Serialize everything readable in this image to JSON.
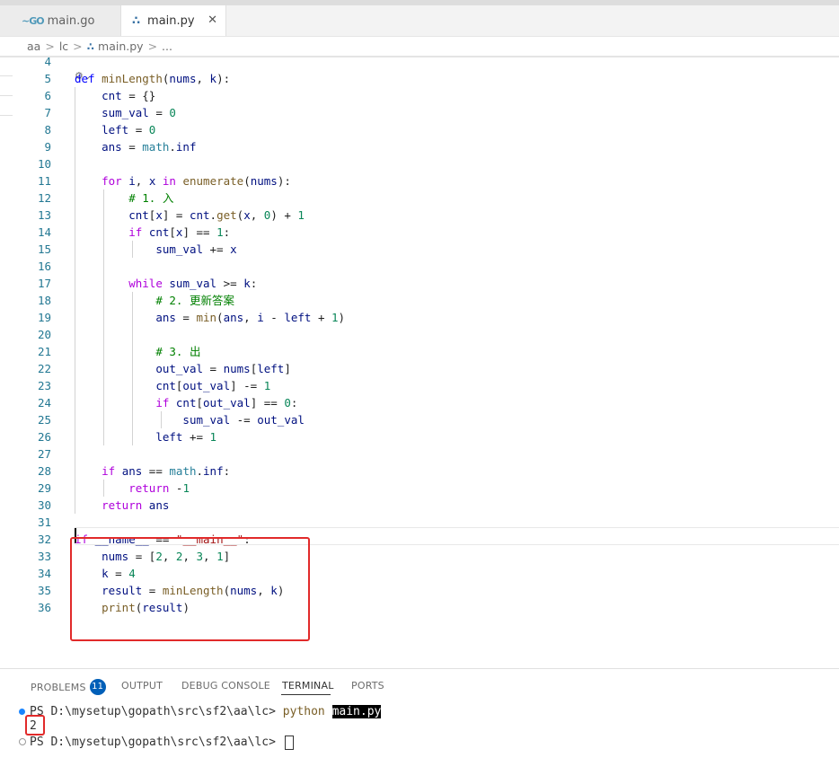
{
  "tabs": [
    {
      "label": "main.go",
      "icon": "go-file-icon",
      "active": false
    },
    {
      "label": "main.py",
      "icon": "python-file-icon",
      "active": true
    }
  ],
  "tab_close_glyph": "✕",
  "breadcrumb": {
    "items": [
      "aa",
      "lc",
      "main.py",
      "..."
    ]
  },
  "editor": {
    "line_numbers": [
      "4",
      "5",
      "6",
      "7",
      "8",
      "9",
      "10",
      "11",
      "12",
      "13",
      "14",
      "15",
      "16",
      "17",
      "18",
      "19",
      "20",
      "21",
      "22",
      "23",
      "24",
      "25",
      "26",
      "27",
      "28",
      "29",
      "30",
      "31",
      "32",
      "33",
      "34",
      "35",
      "36"
    ],
    "code_lines": [
      "",
      "def minLength(nums, k):",
      "    cnt = {}",
      "    sum_val = 0",
      "    left = 0",
      "    ans = math.inf",
      "",
      "    for i, x in enumerate(nums):",
      "        # 1. 入",
      "        cnt[x] = cnt.get(x, 0) + 1",
      "        if cnt[x] == 1:",
      "            sum_val += x",
      "",
      "        while sum_val >= k:",
      "            # 2. 更新答案",
      "            ans = min(ans, i - left + 1)",
      "",
      "            # 3. 出",
      "            out_val = nums[left]",
      "            cnt[out_val] -= 1",
      "            if cnt[out_val] == 0:",
      "                sum_val -= out_val",
      "            left += 1",
      "",
      "    if ans == math.inf:",
      "        return -1",
      "    return ans",
      "",
      "if __name__ == \"__main__\":",
      "    nums = [2, 2, 3, 1]",
      "    k = 4",
      "    result = minLength(nums, k)",
      "    print(result)"
    ]
  },
  "panel": {
    "tabs": [
      {
        "label": "PROBLEMS",
        "badge": "11"
      },
      {
        "label": "OUTPUT"
      },
      {
        "label": "DEBUG CONSOLE"
      },
      {
        "label": "TERMINAL",
        "active": true
      },
      {
        "label": "PORTS"
      }
    ]
  },
  "terminal": {
    "prompt": "PS D:\\mysetup\\gopath\\src\\sf2\\aa\\lc> ",
    "command": "python",
    "argument": "main.py",
    "output": "2"
  },
  "colors": {
    "accent": "#005fb8",
    "highlight_box": "#e12a2a"
  }
}
